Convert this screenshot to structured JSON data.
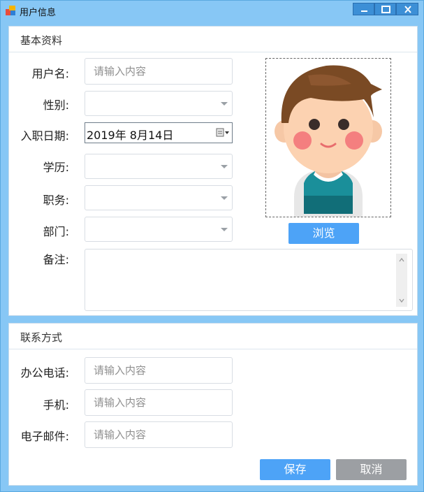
{
  "window": {
    "title": "用户信息",
    "controls": {
      "minimize": "minimize-icon",
      "maximize": "maximize-icon",
      "close": "close-icon"
    }
  },
  "basic": {
    "section_title": "基本资料",
    "username": {
      "label": "用户名:",
      "placeholder": "请输入内容",
      "value": ""
    },
    "gender": {
      "label": "性别:",
      "value": ""
    },
    "hire_date": {
      "label": "入职日期:",
      "value": "2019年  8月14日"
    },
    "education": {
      "label": "学历:",
      "value": ""
    },
    "position": {
      "label": "职务:",
      "value": ""
    },
    "department": {
      "label": "部门:",
      "value": ""
    },
    "remark": {
      "label": "备注:",
      "value": ""
    },
    "browse_label": "浏览"
  },
  "contact": {
    "section_title": "联系方式",
    "office_phone": {
      "label": "办公电话:",
      "placeholder": "请输入内容",
      "value": ""
    },
    "mobile": {
      "label": "手机:",
      "placeholder": "请输入内容",
      "value": ""
    },
    "email": {
      "label": "电子邮件:",
      "placeholder": "请输入内容",
      "value": ""
    }
  },
  "actions": {
    "save_label": "保存",
    "cancel_label": "取消"
  },
  "colors": {
    "window_frame": "#87c7f5",
    "primary_button": "#4da3f7",
    "secondary_button": "#9c9fa3",
    "title_button": "#3c8fd6"
  }
}
